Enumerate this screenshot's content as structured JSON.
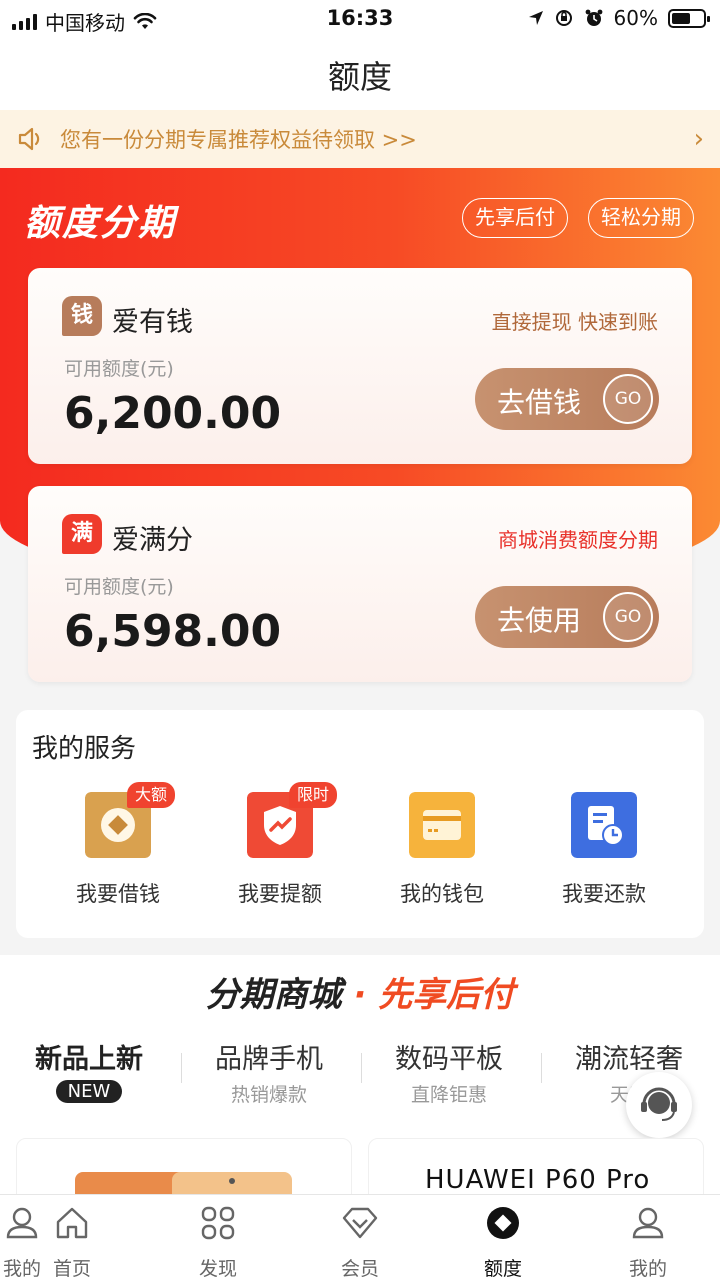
{
  "status_bar": {
    "carrier": "中国移动",
    "time": "16:33",
    "battery": "60%"
  },
  "header": {
    "title": "额度"
  },
  "notice": {
    "text": "您有一份分期专属推荐权益待领取 >>",
    "arrow": "›"
  },
  "banner": {
    "title": "额度分期",
    "pills": [
      "先享后付",
      "轻松分期"
    ]
  },
  "cards": [
    {
      "logo": "钱",
      "name": "爱有钱",
      "tag": "直接提现 快速到账",
      "tag_color": "#b0683a",
      "label": "可用额度(元)",
      "amount": "6,200.00",
      "button": "去借钱",
      "go": "GO",
      "logo_color": "#b77c5b"
    },
    {
      "logo": "满",
      "name": "爱满分",
      "tag": "商城消费额度分期",
      "tag_color": "#e8312a",
      "label": "可用额度(元)",
      "amount": "6,598.00",
      "button": "去使用",
      "go": "GO",
      "logo_color": "#ef3b2c"
    }
  ],
  "services": {
    "title": "我的服务",
    "items": [
      {
        "label": "我要借钱",
        "badge": "大额",
        "icon": "coin-icon"
      },
      {
        "label": "我要提额",
        "badge": "限时",
        "icon": "shield-up-icon"
      },
      {
        "label": "我的钱包",
        "badge": "",
        "icon": "wallet-card-icon"
      },
      {
        "label": "我要还款",
        "badge": "",
        "icon": "bill-clock-icon"
      }
    ]
  },
  "mall": {
    "title_a": "分期商城",
    "dot": "·",
    "title_b": "先享后付",
    "categories": [
      {
        "title": "新品上新",
        "sub": "NEW"
      },
      {
        "title": "品牌手机",
        "sub": "热销爆款"
      },
      {
        "title": "数码平板",
        "sub": "直降钜惠"
      },
      {
        "title": "潮流轻奢",
        "sub": "天天"
      }
    ],
    "product_right": "HUAWEI P60 Pro"
  },
  "tabbar": {
    "items": [
      {
        "label": "我的",
        "icon": "person-icon"
      },
      {
        "label": "首页",
        "icon": "home-icon"
      },
      {
        "label": "发现",
        "icon": "grid-icon"
      },
      {
        "label": "会员",
        "icon": "diamond-icon"
      },
      {
        "label": "额度",
        "icon": "quota-icon"
      },
      {
        "label": "我的",
        "icon": "person-icon"
      }
    ],
    "active": "额度"
  },
  "colors": {
    "accent": "#f42a1f",
    "gold": "#b77c5b",
    "notice_text": "#c98a3a"
  }
}
